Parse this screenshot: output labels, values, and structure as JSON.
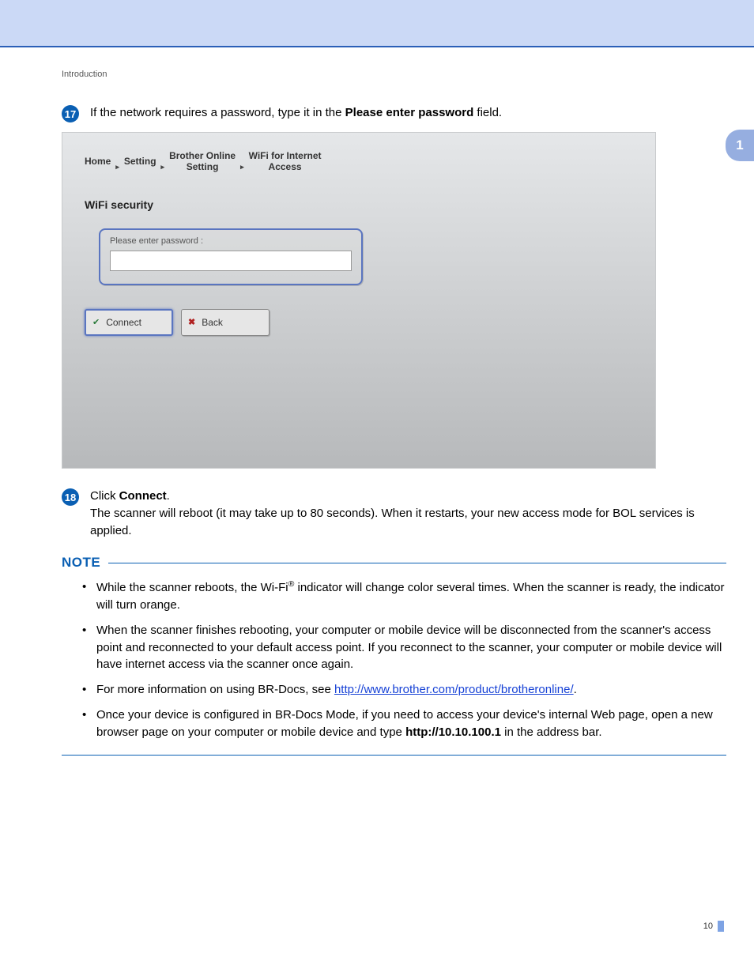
{
  "header": {
    "section": "Introduction",
    "chapter": "1",
    "page_number": "10"
  },
  "steps": {
    "s17": {
      "num": "17",
      "text_before": "If the network requires a password, type it in the ",
      "bold": "Please enter password",
      "text_after": " field."
    },
    "s18": {
      "num": "18",
      "line1_before": "Click ",
      "line1_bold": "Connect",
      "line1_after": ".",
      "line2": "The scanner will reboot (it may take up to 80 seconds). When it restarts, your new access mode for BOL services is applied."
    }
  },
  "screenshot": {
    "crumbs": {
      "c1": "Home",
      "c2": "Setting",
      "c3a": "Brother Online",
      "c3b": "Setting",
      "c4a": "WiFi for Internet",
      "c4b": "Access"
    },
    "title": "WiFi security",
    "password_label": "Please enter password :",
    "password_value": "",
    "connect": "Connect",
    "back": "Back"
  },
  "note": {
    "title": "NOTE",
    "n1a": "While the scanner reboots, the Wi-Fi",
    "n1b": " indicator will change color several times. When the scanner is ready, the indicator will turn orange.",
    "n2": "When the scanner finishes rebooting, your computer or mobile device will be disconnected from the scanner's access point and reconnected to your default access point. If you reconnect to the scanner, your computer or mobile device will have internet access via the scanner once again.",
    "n3a": "For more information on using BR-Docs, see ",
    "n3link": "http://www.brother.com/product/brotheronline/",
    "n3b": ".",
    "n4a": "Once your device is configured in BR-Docs Mode, if you need to access your device's internal Web page, open a new browser page on your computer or mobile device and type ",
    "n4bold": "http://10.10.100.1",
    "n4b": " in the address bar."
  }
}
